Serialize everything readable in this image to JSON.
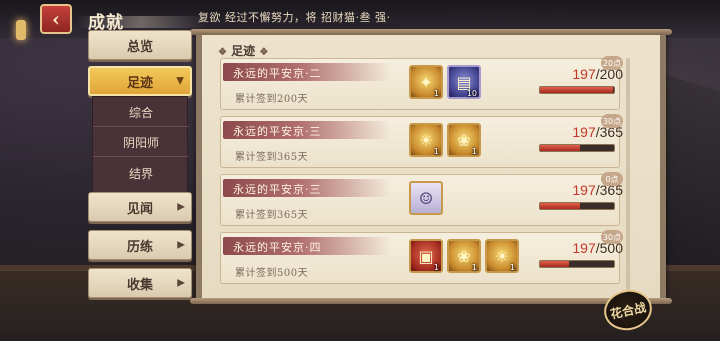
{
  "header": {
    "back_icon": "chevron-left-icon",
    "title": "成就",
    "marquee": "复欲 经过不懈努力，将 招财猫·叁 强·"
  },
  "sidebar": {
    "items": [
      {
        "label": "总览",
        "active": false
      },
      {
        "label": "足迹",
        "active": true,
        "arrow": "▼"
      },
      {
        "label": "见闻",
        "active": false,
        "arrow": "▶"
      },
      {
        "label": "历练",
        "active": false,
        "arrow": "▶"
      },
      {
        "label": "收集",
        "active": false,
        "arrow": "▶"
      }
    ],
    "sub_items": [
      "综合",
      "阴阳师",
      "结界"
    ]
  },
  "section": {
    "title": "足迹"
  },
  "rows": [
    {
      "title": "永远的平安京·二",
      "desc": "累计签到200天",
      "rewards": [
        {
          "icon": "coin-star-icon",
          "qty": "1",
          "style": "gold"
        },
        {
          "icon": "blue-talisman-icon",
          "qty": "10",
          "style": "blue"
        }
      ],
      "current": "197",
      "total": "200",
      "progress": 0.985,
      "badge": "20点"
    },
    {
      "title": "永远的平安京·三",
      "desc": "累计签到365天",
      "rewards": [
        {
          "icon": "sun-token-icon",
          "qty": "1",
          "style": "gold"
        },
        {
          "icon": "ssr-cat-icon",
          "qty": "1",
          "style": "gold"
        }
      ],
      "current": "197",
      "total": "365",
      "progress": 0.54,
      "badge": "30点"
    },
    {
      "title": "永远的平安京·三",
      "desc": "累计签到365天",
      "rewards": [
        {
          "icon": "white-hair-character-icon",
          "qty": "",
          "style": "char"
        }
      ],
      "current": "197",
      "total": "365",
      "progress": 0.54,
      "badge": "0点"
    },
    {
      "title": "永远的平安京·四",
      "desc": "累计签到500天",
      "rewards": [
        {
          "icon": "red-gift-box-icon",
          "qty": "1",
          "style": "red"
        },
        {
          "icon": "fortune-cat-icon",
          "qty": "1",
          "style": "gold"
        },
        {
          "icon": "sun-token-icon",
          "qty": "1",
          "style": "gold"
        }
      ],
      "current": "197",
      "total": "500",
      "progress": 0.394,
      "badge": "30点"
    }
  ],
  "emblem": {
    "label": "花合战"
  }
}
